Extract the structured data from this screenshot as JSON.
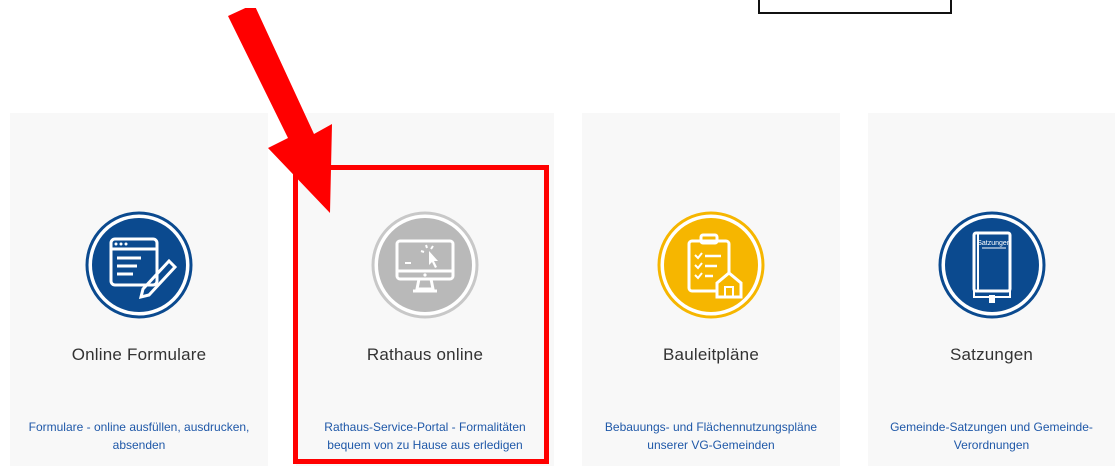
{
  "cards": [
    {
      "title": "Online Formulare",
      "desc": "Formulare - online ausfüllen, ausdrucken, absenden",
      "icon": "form-edit-icon"
    },
    {
      "title": "Rathaus online",
      "desc": "Rathaus-Service-Portal - Formalitäten bequem von zu Hause aus erledigen",
      "icon": "monitor-click-icon"
    },
    {
      "title": "Bauleitpläne",
      "desc": "Bebauungs- und Flächennutzungspläne unserer VG-Gemeinden",
      "icon": "clipboard-house-icon"
    },
    {
      "title": "Satzungen",
      "desc": "Gemeinde-Satzungen und Gemeinde-Verordnungen",
      "icon": "book-icon",
      "book_label": "Satzungen"
    }
  ],
  "colors": {
    "blue": "#0b4a8f",
    "gray": "#b9b9b9",
    "yellow": "#f6b600",
    "link": "#1f58a8",
    "annotation_red": "#ff0000"
  }
}
